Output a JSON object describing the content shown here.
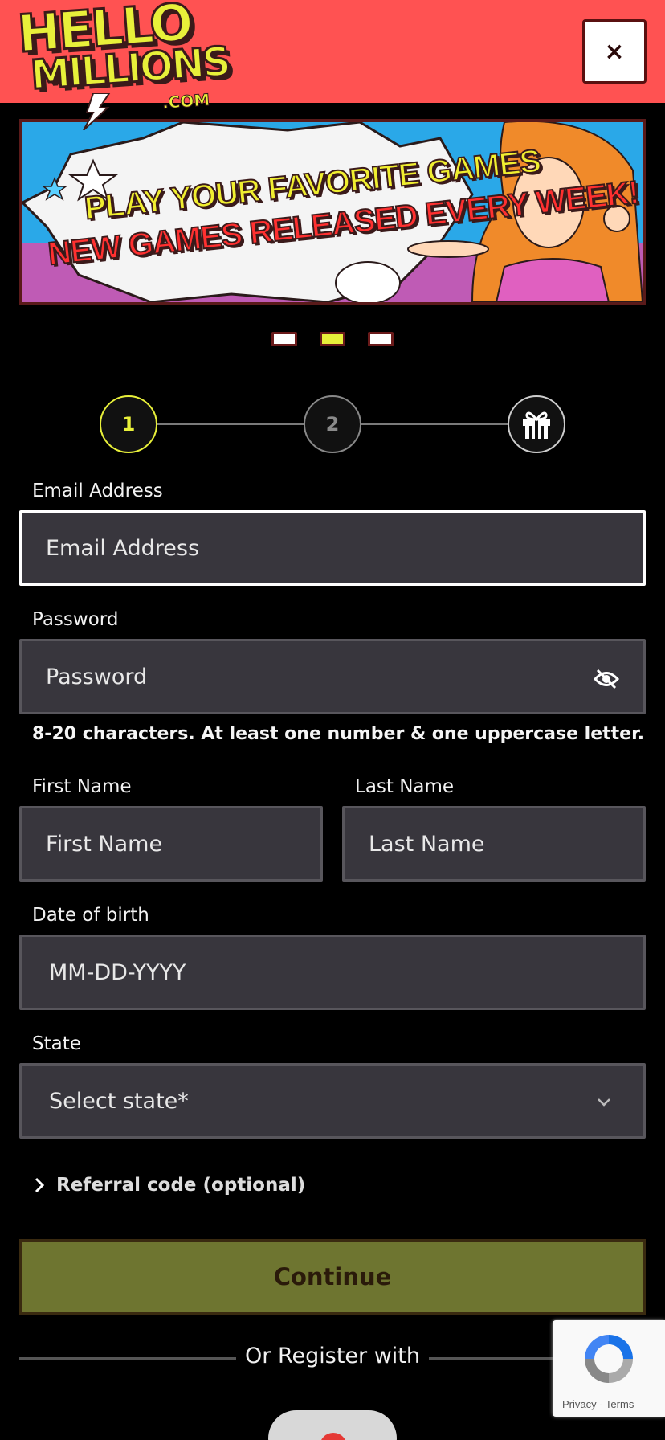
{
  "header": {
    "logo_line1": "HELLO",
    "logo_line2": "MILLIONS",
    "logo_suffix": ".COM",
    "close_label": "×"
  },
  "banner": {
    "line1": "PLAY YOUR FAVORITE GAMES",
    "line2": "NEW GAMES RELEASED EVERY WEEK!"
  },
  "carousel": {
    "slides": 3,
    "active_index": 1
  },
  "stepper": {
    "steps": [
      "1",
      "2"
    ],
    "active_step": 1,
    "final_step_icon": "gift-icon"
  },
  "form": {
    "email": {
      "label": "Email Address",
      "placeholder": "Email Address"
    },
    "password": {
      "label": "Password",
      "placeholder": "Password",
      "hint": "8-20 characters. At least one number & one uppercase letter."
    },
    "first_name": {
      "label": "First Name",
      "placeholder": "First Name"
    },
    "last_name": {
      "label": "Last Name",
      "placeholder": "Last Name"
    },
    "dob": {
      "label": "Date of birth",
      "placeholder": "MM-DD-YYYY"
    },
    "state": {
      "label": "State",
      "value": "Select state*"
    },
    "referral_label": "Referral code (optional)",
    "continue_label": "Continue",
    "or_register_label": "Or Register with"
  },
  "recaptcha": {
    "links": "Privacy - Terms"
  },
  "colors": {
    "header_bg": "#ff5252",
    "accent_yellow": "#e8f03a",
    "field_bg": "#38363d",
    "continue_bg": "#6e7530"
  }
}
